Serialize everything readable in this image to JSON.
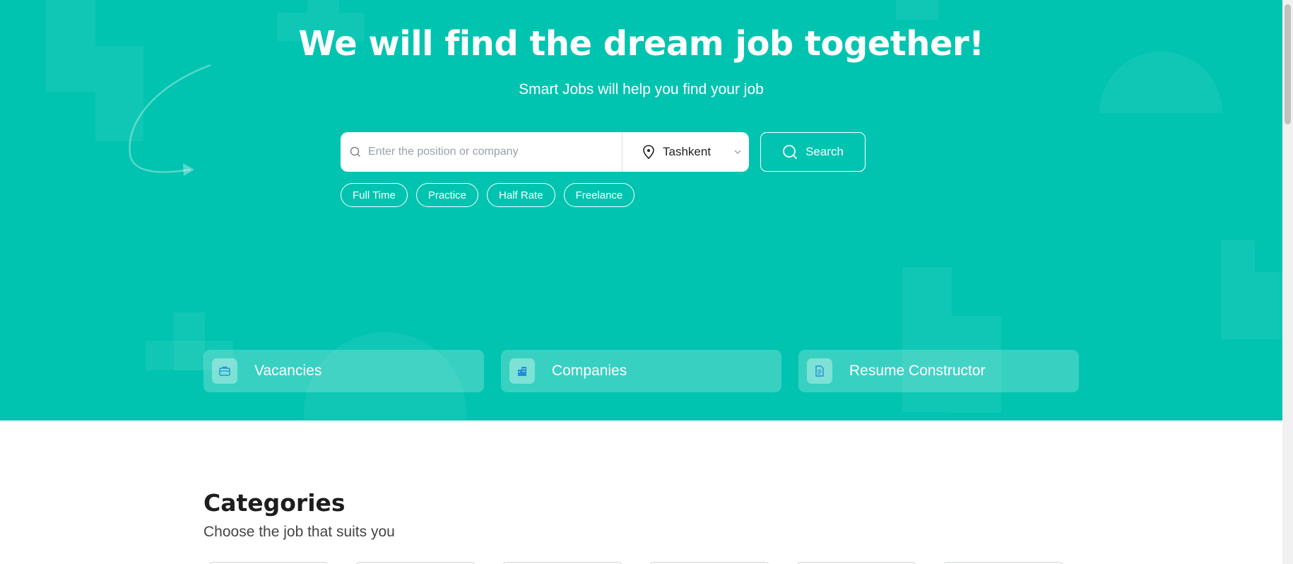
{
  "hero": {
    "title": "We will find the dream job together!",
    "subtitle": "Smart Jobs will help you find your job",
    "bg_color": "#00c4b0"
  },
  "search": {
    "placeholder": "Enter the position or company",
    "value": "",
    "location": "Tashkent",
    "button_label": "Search"
  },
  "chips": [
    {
      "label": "Full Time"
    },
    {
      "label": "Practice"
    },
    {
      "label": "Half Rate"
    },
    {
      "label": "Freelance"
    }
  ],
  "hero_cards": [
    {
      "label": "Vacancies",
      "icon": "briefcase-icon"
    },
    {
      "label": "Companies",
      "icon": "building-icon"
    },
    {
      "label": "Resume Constructor",
      "icon": "document-icon"
    }
  ],
  "categories": {
    "title": "Categories",
    "subtitle": "Choose the job that suits you"
  }
}
